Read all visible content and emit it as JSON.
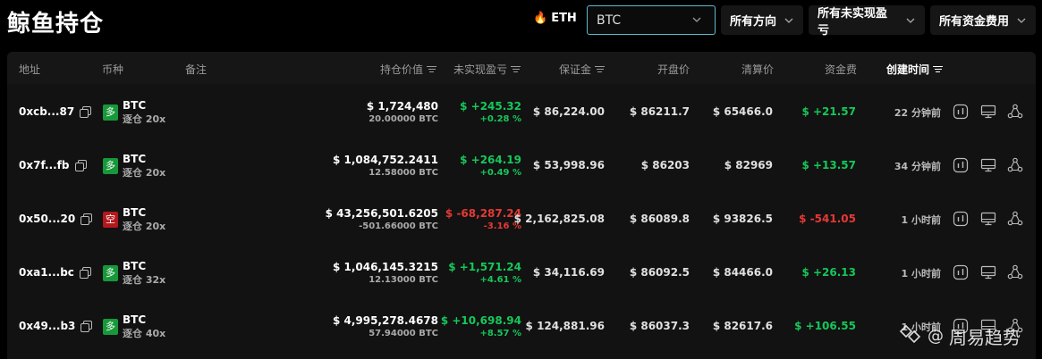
{
  "page": {
    "title": "鲸鱼持仓"
  },
  "toolbar": {
    "eth_label": "ETH",
    "coin_select_value": "BTC",
    "filters": [
      "所有方向",
      "所有未实现盈亏",
      "所有资金费用"
    ]
  },
  "table": {
    "columns": [
      "地址",
      "币种",
      "备注",
      "持仓价值",
      "未实现盈亏",
      "保证金",
      "开盘价",
      "清算价",
      "资金费",
      "创建时间"
    ],
    "rows": [
      {
        "address": "0xcb...87",
        "side": "多",
        "side_type": "long",
        "coin": "BTC",
        "leverage": "逐仓 20x",
        "value_usd": "$ 1,724,480",
        "value_btc": "20.00000 BTC",
        "pnl": "$ +245.32",
        "pnl_pct": "+0.28 %",
        "pnl_dir": "pos",
        "margin": "$ 86,224.00",
        "open_price": "$ 86211.7",
        "liq_price": "$ 65466.0",
        "funding": "$ +21.57",
        "funding_dir": "pos",
        "time": "22 分钟前"
      },
      {
        "address": "0x7f...fb",
        "side": "多",
        "side_type": "long",
        "coin": "BTC",
        "leverage": "逐仓 20x",
        "value_usd": "$ 1,084,752.2411",
        "value_btc": "12.58000 BTC",
        "pnl": "$ +264.19",
        "pnl_pct": "+0.49 %",
        "pnl_dir": "pos",
        "margin": "$ 53,998.96",
        "open_price": "$ 86203",
        "liq_price": "$ 82969",
        "funding": "$ +13.57",
        "funding_dir": "pos",
        "time": "34 分钟前"
      },
      {
        "address": "0x50...20",
        "side": "空",
        "side_type": "short",
        "coin": "BTC",
        "leverage": "逐仓 20x",
        "value_usd": "$ 43,256,501.6205",
        "value_btc": "-501.66000 BTC",
        "pnl": "$ -68,287.24",
        "pnl_pct": "-3.16 %",
        "pnl_dir": "neg",
        "margin": "$ 2,162,825.08",
        "open_price": "$ 86089.8",
        "liq_price": "$ 93826.5",
        "funding": "$ -541.05",
        "funding_dir": "neg",
        "time": "1 小时前"
      },
      {
        "address": "0xa1...bc",
        "side": "多",
        "side_type": "long",
        "coin": "BTC",
        "leverage": "逐仓 32x",
        "value_usd": "$ 1,046,145.3215",
        "value_btc": "12.13000 BTC",
        "pnl": "$ +1,571.24",
        "pnl_pct": "+4.61 %",
        "pnl_dir": "pos",
        "margin": "$ 34,116.69",
        "open_price": "$ 86092.5",
        "liq_price": "$ 84466.0",
        "funding": "$ +26.13",
        "funding_dir": "pos",
        "time": "1 小时前"
      },
      {
        "address": "0x49...b3",
        "side": "多",
        "side_type": "long",
        "coin": "BTC",
        "leverage": "逐仓 40x",
        "value_usd": "$ 4,995,278.4678",
        "value_btc": "57.94000 BTC",
        "pnl": "$ +10,698.94",
        "pnl_pct": "+8.57 %",
        "pnl_dir": "pos",
        "margin": "$ 124,881.96",
        "open_price": "$ 86037.3",
        "liq_price": "$ 82617.6",
        "funding": "$ +106.55",
        "funding_dir": "pos",
        "time": "1 小时前"
      }
    ],
    "row_actions": [
      "chart-icon",
      "monitor-icon",
      "share-icon"
    ]
  },
  "colors": {
    "positive": "#16c75a",
    "negative": "#e53935",
    "select_border": "#5fb9c9"
  },
  "watermark": {
    "text": "周易趋势"
  }
}
